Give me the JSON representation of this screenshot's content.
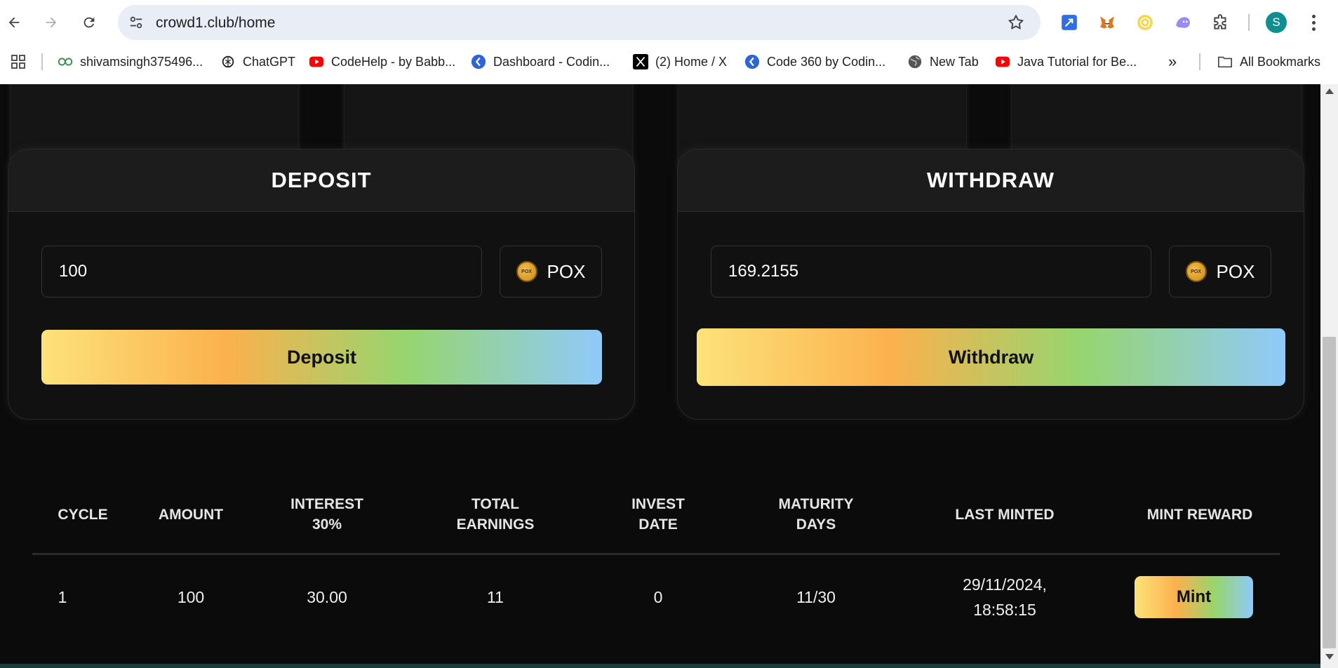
{
  "browser": {
    "url": "crowd1.club/home",
    "profile_initial": "S",
    "bookmarks": [
      {
        "label": "shivamsingh375496...",
        "icon": "geeksforgeeks-icon"
      },
      {
        "label": "ChatGPT",
        "icon": "chatgpt-icon"
      },
      {
        "label": "CodeHelp - by Babb...",
        "icon": "youtube-icon"
      },
      {
        "label": "Dashboard - Codin...",
        "icon": "codingninjas-icon"
      },
      {
        "label": "(2) Home / X",
        "icon": "x-icon"
      },
      {
        "label": "Code 360 by Codin...",
        "icon": "codingninjas-icon"
      },
      {
        "label": "New Tab",
        "icon": "globe-icon"
      },
      {
        "label": "Java Tutorial for Be...",
        "icon": "youtube-icon"
      }
    ],
    "more_bookmarks": "»",
    "all_bookmarks": "All Bookmarks"
  },
  "deposit": {
    "title": "DEPOSIT",
    "amount": "100",
    "token": "POX",
    "button": "Deposit"
  },
  "withdraw": {
    "title": "WITHDRAW",
    "amount": "169.2155",
    "token": "POX",
    "button": "Withdraw"
  },
  "coin_label": "POX",
  "table": {
    "headers": {
      "cycle": "CYCLE",
      "amount": "AMOUNT",
      "interest_1": "INTEREST",
      "interest_2": "30%",
      "total_1": "TOTAL",
      "total_2": "EARNINGS",
      "invest_1": "INVEST",
      "invest_2": "DATE",
      "maturity_1": "MATURITY",
      "maturity_2": "DAYS",
      "last_minted": "LAST MINTED",
      "mint_reward": "MINT REWARD"
    },
    "rows": [
      {
        "cycle": "1",
        "amount": "100",
        "interest": "30.00",
        "total_earnings": "11",
        "invest_date": "0",
        "maturity_days": "11/30",
        "last_minted_1": "29/11/2024,",
        "last_minted_2": "18:58:15",
        "action": "Mint"
      }
    ]
  },
  "colors": {
    "background": "#0b0b0b",
    "panel": "#111111",
    "gradient": [
      "#fde27a",
      "#fbb14d",
      "#97d56f",
      "#8fcafb"
    ]
  }
}
